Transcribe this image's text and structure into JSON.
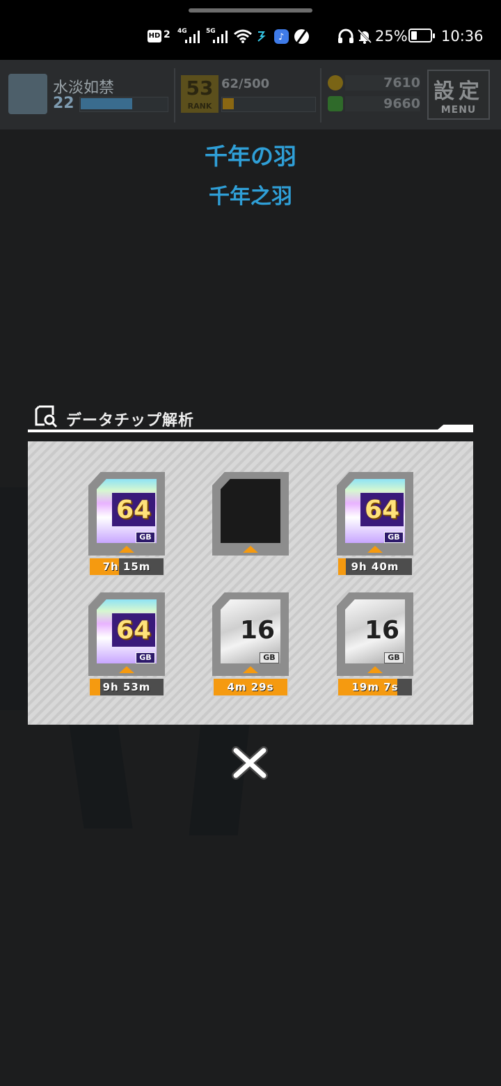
{
  "status_bar": {
    "hd_badge": "HD",
    "sim_slot": "2",
    "net1": "4G",
    "net2": "5G",
    "battery": "25%",
    "time": "10:36",
    "icons": [
      "wifi-icon",
      "data-arrows-icon",
      "music-app-icon",
      "ball-app-icon",
      "headphones-icon",
      "mute-bell-icon",
      "battery-icon"
    ]
  },
  "game_bar": {
    "player_name": "水淡如禁",
    "player_level": "22",
    "level_progress": 0.6,
    "rank_number": "53",
    "rank_label": "RANK",
    "stamina": "62/500",
    "stamina_progress": 0.12,
    "currency1": "7610",
    "currency2": "9660",
    "menu_kanji": "設定",
    "menu_label": "MENU"
  },
  "titles": {
    "ja": "千年の羽",
    "zh": "千年之羽"
  },
  "panel": {
    "title": "データチップ解析",
    "chips": [
      {
        "kind": "gold",
        "capacity": "64",
        "unit": "GB",
        "timer": "7h 15m",
        "progress": 0.4
      },
      {
        "kind": "empty",
        "capacity": "",
        "unit": "",
        "timer": "",
        "progress": 0
      },
      {
        "kind": "gold",
        "capacity": "64",
        "unit": "GB",
        "timer": "9h 40m",
        "progress": 0.1
      },
      {
        "kind": "gold",
        "capacity": "64",
        "unit": "GB",
        "timer": "9h 53m",
        "progress": 0.14
      },
      {
        "kind": "silver",
        "capacity": "16",
        "unit": "GB",
        "timer": "4m 29s",
        "progress": 1.0
      },
      {
        "kind": "silver",
        "capacity": "16",
        "unit": "GB",
        "timer": "19m 7s",
        "progress": 0.8
      }
    ]
  },
  "colors": {
    "title_blue": "#2f9fd7",
    "timer_orange": "#f59a10",
    "background": "#1c1d1e"
  }
}
